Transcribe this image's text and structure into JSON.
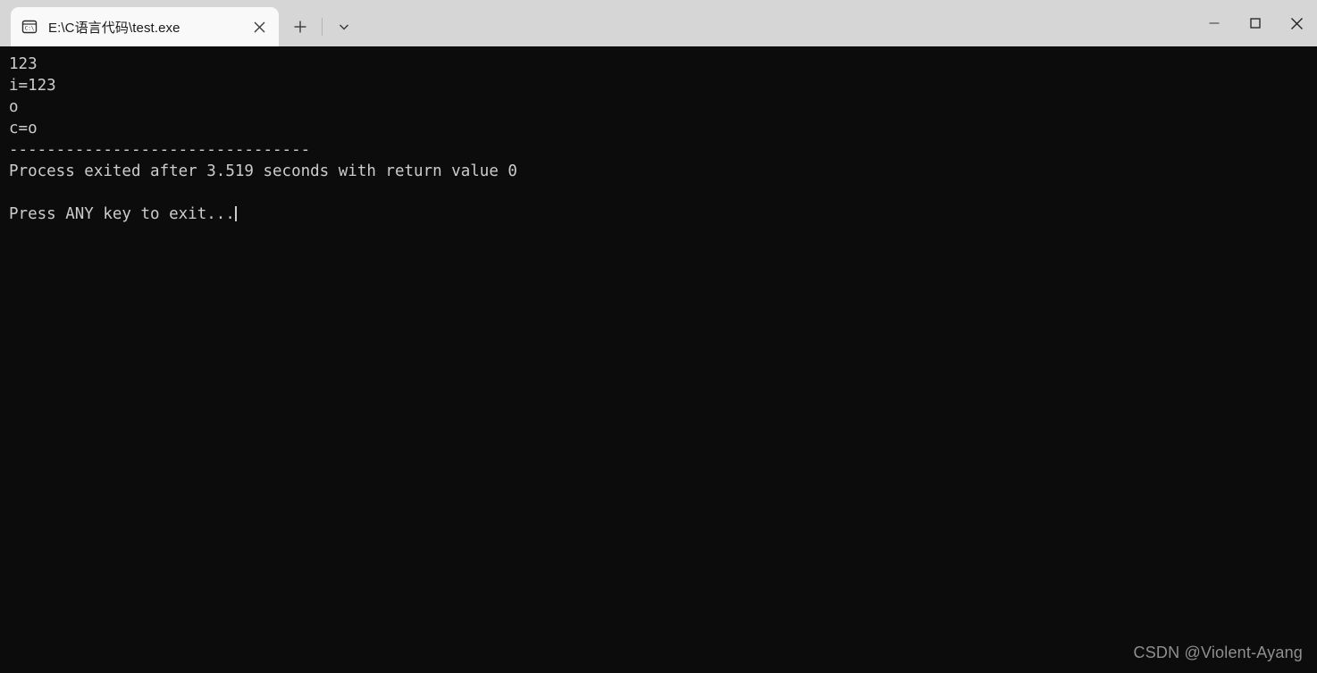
{
  "window": {
    "tab": {
      "title": "E:\\C语言代码\\test.exe",
      "icon": "console-window-icon",
      "icon_text": "C:\\",
      "close_icon": "close-icon"
    },
    "new_tab_icon": "plus-icon",
    "dropdown_icon": "chevron-down-icon",
    "controls": {
      "minimize_icon": "minimize-icon",
      "maximize_icon": "maximize-icon",
      "close_icon": "close-icon"
    },
    "colors": {
      "titlebar_bg": "#d6d6d6",
      "tab_bg": "#f9f9f9",
      "terminal_bg": "#0c0c0c",
      "terminal_fg": "#cccccc",
      "watermark_fg": "#8f8f8f"
    }
  },
  "terminal": {
    "lines": [
      "123",
      "i=123",
      "o",
      "c=o",
      "--------------------------------",
      "Process exited after 3.519 seconds with return value 0",
      "",
      "Press ANY key to exit..."
    ]
  },
  "watermark": {
    "text": "CSDN @Violent-Ayang"
  }
}
